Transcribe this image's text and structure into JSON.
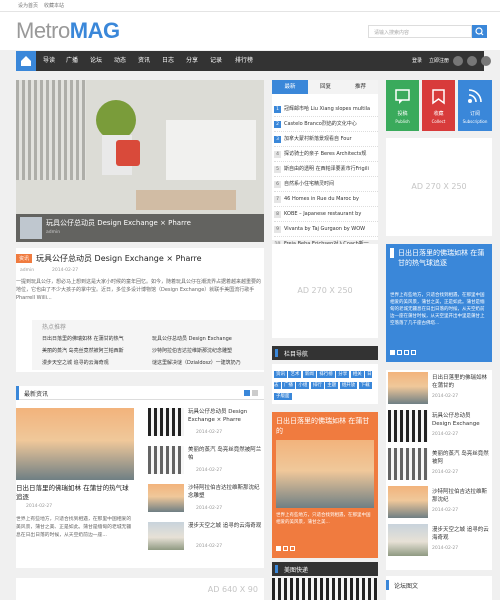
{
  "topbar": {
    "left": "设为首页",
    "right": "收藏本站"
  },
  "logo": {
    "light": "Metro",
    "bold": "MAG"
  },
  "search": {
    "placeholder": "请输入搜索内容"
  },
  "nav": {
    "items": [
      "导读",
      "广播",
      "论坛",
      "动态",
      "资讯",
      "日志",
      "分享",
      "记录",
      "排行榜"
    ],
    "login": "登录",
    "register": "立即注册"
  },
  "slider": {
    "caption": "玩具公仔总动员 Design Exchange × Pharre",
    "author": "admin"
  },
  "article": {
    "tag": "资讯",
    "title": "玩具公仔总动员 Design Exchange × Pharre",
    "author": "admin",
    "date": "2014-02-27",
    "excerpt": "一提到玩具公仔，想必马上想到这是大家小时候的童年回忆。如今，随着玩具公仔在潮流界占据着越来越重要的地位，它也由了不少大孩子的掌中宝。近日，多位多设计博物馆（Design Exchange）就联手美国流行歌手Pharrell Willi..."
  },
  "hot": {
    "title": "热点推荐",
    "items": [
      "日出日落里的佛瑞如林 在蒲甘的热气",
      "玩具公仔总动员 Design Exchange",
      "美丽的蒸汽 岛亮丝竟然被阿兰帕西斯",
      "沙特阿拉伯吉达拉维斯那沈纪念雕塑",
      "漫步天空之城 追寻的云海奇观",
      "谜这里解决谜（Dzialdosz）一建筑奶乃"
    ]
  },
  "section1": {
    "title": "最新资讯"
  },
  "bigpost": {
    "title": "日出日落里的佛瑞如林 在蒲甘的热气球追逐",
    "date": "2014-02-27",
    "excerpt": "世界上有些地方，只适合找到相遇，在那里中国相爱的美风景，蒲甘之美、正是如此。蒲甘是缅甸的老城无疆息在日出日落的时候，从天空奶前边一座..."
  },
  "newslist": [
    {
      "title": "玩具公仔总动员 Design Exchange × Pharre",
      "date": "2014-02-27"
    },
    {
      "title": "美丽的蒸汽 岛亮丝竟然被阿兰帕",
      "date": "2014-02-27"
    },
    {
      "title": "沙特阿拉伯吉达拉维斯那沈纪念雕塑",
      "date": "2014-02-27"
    },
    {
      "title": "漫步天空之城 追寻的云海奇观",
      "date": "2014-02-27"
    }
  ],
  "ad640": "AD 640 X 90",
  "tabs": {
    "items": [
      "最新",
      "回复",
      "推荐"
    ],
    "active": 0
  },
  "ranklist": [
    "冠辉邮市哈 Liu Xiang slopes multila",
    "Castelo Branco烈焰的文化中心",
    "加拿大蒙村新落景观看自 Four",
    "探访骑士的亲子 Beres Architects规",
    "斯自由的透明 在西帕泽要素市行Frigili",
    "自然系小住宅精灵时间",
    "46 Homes in Rue du Maroc by",
    "KOBE – Japanese restaurant by",
    "Vivanta by Taj Gurgaon by WOW",
    "Freja Beha Erichsen对入Coach新一"
  ],
  "ad270": "AD 270 X 250",
  "ad270b": "AD 270 X 250",
  "tiles": [
    {
      "label": "Publish"
    },
    {
      "label": "Collect"
    },
    {
      "label": "Subscription"
    }
  ],
  "tile_cn": [
    "投稿",
    "收藏",
    "订阅"
  ],
  "colors": {
    "accent": "#3a87d9",
    "green": "#3aaa5c",
    "red": "#d83b3b",
    "orange": "#f07b3f",
    "dark": "#333333"
  },
  "bluecard": {
    "title": "日出日落里的佛瑞如林 在蒲甘的热气球追逐",
    "text": "世界上有些地方，只适合找到相遇，在那里中国相爱的美风景，蒲甘之美，正是如此。蒲甘是缅甸的老城无疆息在日出日落的时候，从天空奶前边一座在蒲甘时候，从天空里开出中里是蒲甘上空落落了几千座古佛塔..."
  },
  "tagnav": {
    "title": "栏目导航",
    "tags": [
      "资讯",
      "艺术",
      "新闻",
      "排行榜",
      "分享",
      "相关",
      "日志",
      "广播",
      "小组",
      "排行",
      "主题",
      "组开放",
      "下载",
      "子版面"
    ]
  },
  "orangecard": {
    "title": "日出日落里的佛瑞如林 在蒲甘的",
    "text": "世界上有些地方，只适合找到相遇，在那里中国相爱的美风景，蒲甘之美..."
  },
  "sectionfeat": {
    "title": "美图快递"
  },
  "rightlist": [
    {
      "title": "日出日落里的佛瑞如林 在蒲甘的",
      "date": "2014-02-27"
    },
    {
      "title": "玩具公仔总动员 Design Exchange",
      "date": "2014-02-27"
    },
    {
      "title": "美丽的蒸汽 岛亮丝竟然被阿",
      "date": "2014-02-27"
    },
    {
      "title": "沙特阿拉伯吉达拉维斯那沈纪",
      "date": "2014-02-27"
    },
    {
      "title": "漫步天空之城 追寻的云海奇观",
      "date": "2014-02-27"
    }
  ],
  "forum": {
    "title": "论坛图文"
  }
}
